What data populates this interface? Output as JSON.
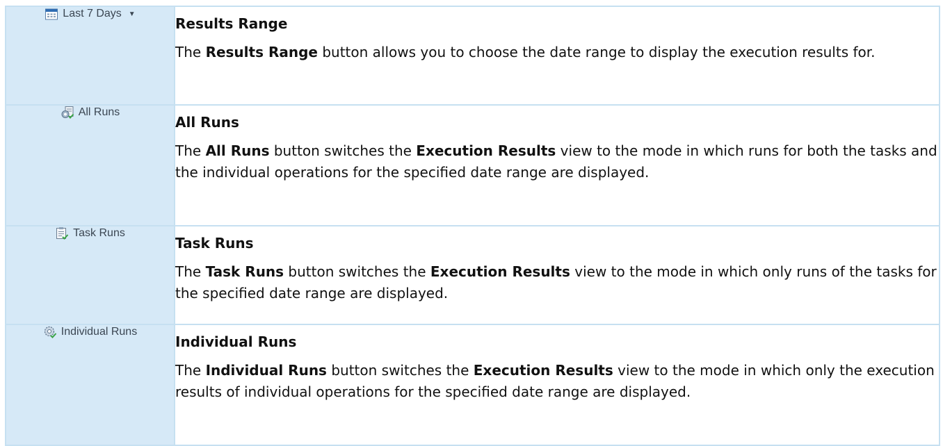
{
  "rows": [
    {
      "button": {
        "label": "Last 7 Days",
        "icon": "calendar-icon",
        "has_dropdown": true
      },
      "title": "Results Range",
      "desc": [
        {
          "t": "The ",
          "b": false
        },
        {
          "t": "Results Range",
          "b": true
        },
        {
          "t": " button allows you to choose the date range to display the execution results for.",
          "b": false
        }
      ]
    },
    {
      "button": {
        "label": "All Runs",
        "icon": "all-runs-icon",
        "has_dropdown": false
      },
      "title": "All Runs",
      "desc": [
        {
          "t": "The ",
          "b": false
        },
        {
          "t": "All Runs",
          "b": true
        },
        {
          "t": " button switches the ",
          "b": false
        },
        {
          "t": "Execution Results",
          "b": true
        },
        {
          "t": " view to the mode in which runs for both the tasks and the individual operations for the specified date range are displayed.",
          "b": false
        }
      ]
    },
    {
      "button": {
        "label": "Task Runs",
        "icon": "task-runs-icon",
        "has_dropdown": false
      },
      "title": "Task Runs",
      "desc": [
        {
          "t": "The ",
          "b": false
        },
        {
          "t": "Task Runs",
          "b": true
        },
        {
          "t": " button switches the ",
          "b": false
        },
        {
          "t": "Execution Results",
          "b": true
        },
        {
          "t": " view to the mode in which only runs of the tasks for the specified date range are displayed.",
          "b": false
        }
      ]
    },
    {
      "button": {
        "label": "Individual Runs",
        "icon": "individual-runs-icon",
        "has_dropdown": false
      },
      "title": "Individual Runs",
      "desc": [
        {
          "t": "The ",
          "b": false
        },
        {
          "t": "Individual Runs",
          "b": true
        },
        {
          "t": " button switches the ",
          "b": false
        },
        {
          "t": "Execution Results",
          "b": true
        },
        {
          "t": " view to the mode in which only the execution results of individual operations for the specified date range are displayed.",
          "b": false
        }
      ]
    }
  ],
  "colors": {
    "button_cell_bg": "#d6e9f7",
    "border": "#c6e0f1",
    "text": "#111111",
    "button_text": "#3b4652"
  }
}
